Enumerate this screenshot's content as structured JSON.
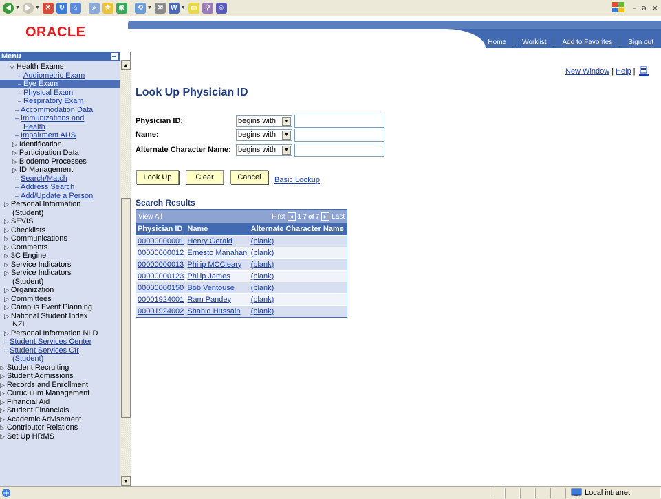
{
  "header": {
    "logo": "ORACLE",
    "links": [
      "Home",
      "Worklist",
      "Add to Favorites",
      "Sign out"
    ]
  },
  "menu": {
    "title": "Menu",
    "items": [
      {
        "label": "Health Exams",
        "glyph": "▽",
        "kind": "folder-open"
      },
      {
        "label": "Audiometric Exam",
        "glyph": "–",
        "kind": "link"
      },
      {
        "label": "Eye Exam",
        "glyph": "–",
        "kind": "selected"
      },
      {
        "label": "Physical Exam",
        "glyph": "–",
        "kind": "link"
      },
      {
        "label": "Respiratory Exam",
        "glyph": "–",
        "kind": "link"
      },
      {
        "label": "Accommodation Data",
        "glyph": "–",
        "kind": "link"
      },
      {
        "label": "Immunizations and",
        "glyph": "–",
        "kind": "link"
      },
      {
        "label": "Health",
        "glyph": "",
        "kind": "link"
      },
      {
        "label": "Impairment AUS",
        "glyph": "–",
        "kind": "link"
      },
      {
        "label": "Identification",
        "glyph": "▷",
        "kind": "folder"
      },
      {
        "label": "Participation Data",
        "glyph": "▷",
        "kind": "folder"
      },
      {
        "label": "Biodemo Processes",
        "glyph": "▷",
        "kind": "folder"
      },
      {
        "label": "ID Management",
        "glyph": "▷",
        "kind": "folder"
      },
      {
        "label": "Search/Match",
        "glyph": "–",
        "kind": "link"
      },
      {
        "label": "Address Search",
        "glyph": "–",
        "kind": "link"
      },
      {
        "label": "Add/Update a Person",
        "glyph": "–",
        "kind": "link"
      },
      {
        "label": "Personal Information",
        "glyph": "▷",
        "kind": "folder"
      },
      {
        "label": "(Student)",
        "glyph": "",
        "kind": "folder"
      },
      {
        "label": "SEVIS",
        "glyph": "▷",
        "kind": "folder"
      },
      {
        "label": "Checklists",
        "glyph": "▷",
        "kind": "folder"
      },
      {
        "label": "Communications",
        "glyph": "▷",
        "kind": "folder"
      },
      {
        "label": "Comments",
        "glyph": "▷",
        "kind": "folder"
      },
      {
        "label": "3C Engine",
        "glyph": "▷",
        "kind": "folder"
      },
      {
        "label": "Service Indicators",
        "glyph": "▷",
        "kind": "folder"
      },
      {
        "label": "Service Indicators",
        "glyph": "▷",
        "kind": "folder"
      },
      {
        "label": "(Student)",
        "glyph": "",
        "kind": "folder"
      },
      {
        "label": "Organization",
        "glyph": "▷",
        "kind": "folder"
      },
      {
        "label": "Committees",
        "glyph": "▷",
        "kind": "folder"
      },
      {
        "label": "Campus Event Planning",
        "glyph": "▷",
        "kind": "folder"
      },
      {
        "label": "National Student Index",
        "glyph": "▷",
        "kind": "folder"
      },
      {
        "label": "NZL",
        "glyph": "",
        "kind": "folder"
      },
      {
        "label": "Personal Information NLD",
        "glyph": "▷",
        "kind": "folder"
      },
      {
        "label": "Student Services Center",
        "glyph": "–",
        "kind": "link"
      },
      {
        "label": "Student Services Ctr",
        "glyph": "–",
        "kind": "link"
      },
      {
        "label": "(Student)",
        "glyph": "",
        "kind": "link"
      },
      {
        "label": "Student Recruiting",
        "glyph": "▷",
        "kind": "top"
      },
      {
        "label": "Student Admissions",
        "glyph": "▷",
        "kind": "top"
      },
      {
        "label": "Records and Enrollment",
        "glyph": "▷",
        "kind": "top"
      },
      {
        "label": "Curriculum Management",
        "glyph": "▷",
        "kind": "top"
      },
      {
        "label": "Financial Aid",
        "glyph": "▷",
        "kind": "top"
      },
      {
        "label": "Student Financials",
        "glyph": "▷",
        "kind": "top"
      },
      {
        "label": "Academic Advisement",
        "glyph": "▷",
        "kind": "top"
      },
      {
        "label": "Contributor Relations",
        "glyph": "▷",
        "kind": "top"
      },
      {
        "label": "Set Up HRMS",
        "glyph": "▷",
        "kind": "top"
      }
    ]
  },
  "toplinks": {
    "new_window": "New Window",
    "help": "Help"
  },
  "page": {
    "title": "Look Up Physician ID",
    "fields": [
      {
        "label": "Physician ID:",
        "operator": "begins with",
        "value": ""
      },
      {
        "label": "Name:",
        "operator": "begins with",
        "value": ""
      },
      {
        "label": "Alternate Character Name:",
        "operator": "begins with",
        "value": ""
      }
    ],
    "buttons": {
      "lookup": "Look Up",
      "clear": "Clear",
      "cancel": "Cancel"
    },
    "basic_lookup": "Basic Lookup"
  },
  "results": {
    "title": "Search Results",
    "view_all": "View All",
    "first": "First",
    "range": "1-7 of 7",
    "last": "Last",
    "columns": [
      "Physician ID",
      "Name",
      "Alternate Character Name"
    ],
    "rows": [
      [
        "00000000001",
        "Henry Gerald",
        "(blank)"
      ],
      [
        "00000000012",
        "Ernesto Manahan",
        "(blank)"
      ],
      [
        "00000000013",
        "Philip MCCleary",
        "(blank)"
      ],
      [
        "00000000123",
        "Philip James",
        "(blank)"
      ],
      [
        "00000000150",
        "Bob Ventouse",
        "(blank)"
      ],
      [
        "00001924001",
        "Ram Pandey",
        "(blank)"
      ],
      [
        "00001924002",
        "Shahid Hussain",
        "(blank)"
      ]
    ]
  },
  "statusbar": {
    "zone": "Local intranet"
  }
}
